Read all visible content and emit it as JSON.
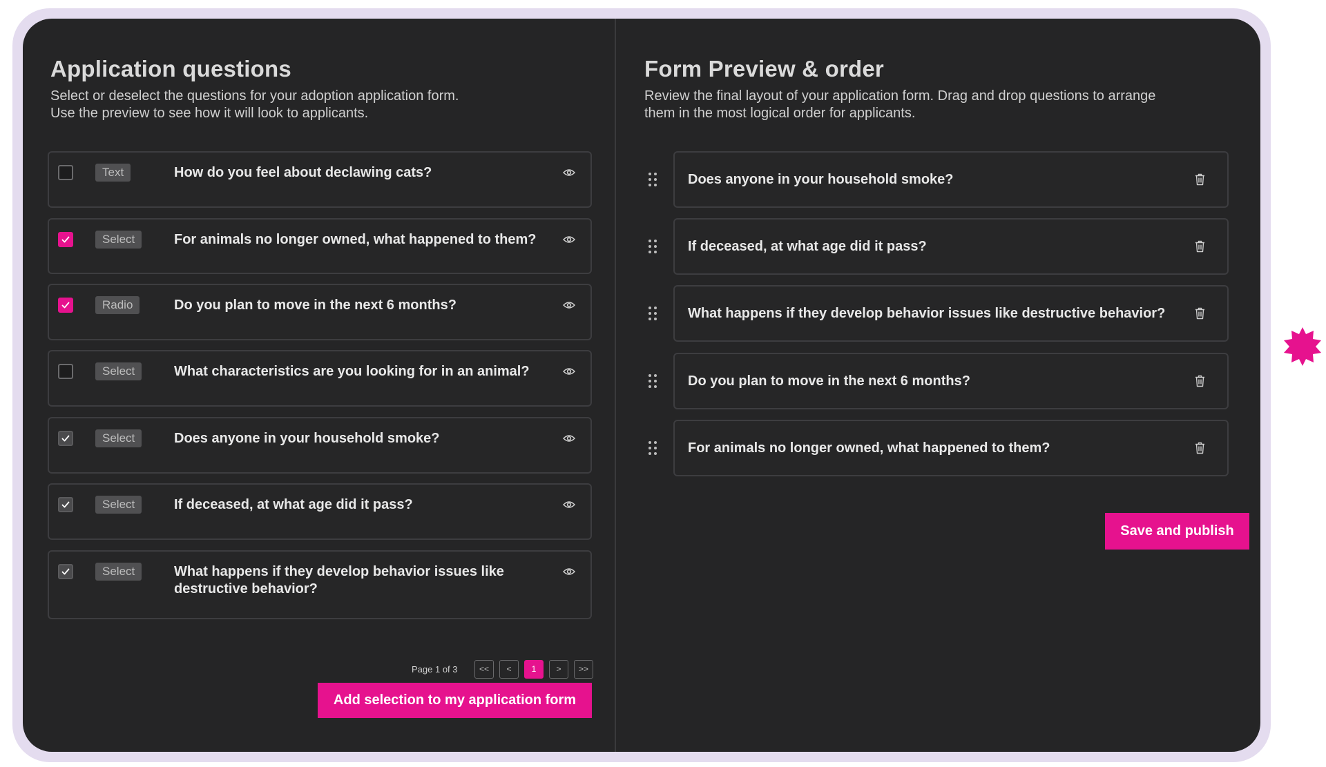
{
  "accent_color": "#e6128e",
  "left": {
    "title": "Application questions",
    "description": "Select or deselect the questions for your adoption application form.\nUse the preview to see how it will look to applicants.",
    "questions": [
      {
        "type": "Text",
        "text": "How do you feel about declawing cats?",
        "checked": false,
        "check_style": "none"
      },
      {
        "type": "Select",
        "text": "For animals no longer owned, what happened to them?",
        "checked": true,
        "check_style": "accent"
      },
      {
        "type": "Radio",
        "text": "Do you plan to move in the next 6 months?",
        "checked": true,
        "check_style": "accent"
      },
      {
        "type": "Select",
        "text": "What characteristics are you looking for in an animal?",
        "checked": false,
        "check_style": "none"
      },
      {
        "type": "Select",
        "text": "Does anyone in your household smoke?",
        "checked": true,
        "check_style": "muted"
      },
      {
        "type": "Select",
        "text": "If deceased, at what age did it pass?",
        "checked": true,
        "check_style": "muted"
      },
      {
        "type": "Select",
        "text": "What happens if they develop behavior issues like destructive behavior?",
        "checked": true,
        "check_style": "muted"
      }
    ],
    "pagination": {
      "label": "Page 1 of 3",
      "first": "<<",
      "prev": "<",
      "current": "1",
      "next": ">",
      "last": ">>"
    },
    "add_button": "Add selection to my application form"
  },
  "right": {
    "title": "Form Preview & order",
    "description": "Review the final layout of your application form. Drag and drop questions to arrange\nthem in the most logical order for applicants.",
    "items": [
      {
        "text": "Does anyone in your household smoke?"
      },
      {
        "text": "If deceased, at what age did it pass?"
      },
      {
        "text": "What happens if they develop behavior issues like destructive behavior?"
      },
      {
        "text": "Do you plan to move in the next 6 months?"
      },
      {
        "text": "For animals no longer owned, what happened to them?"
      }
    ],
    "save_button": "Save and publish"
  },
  "icons": {
    "row_preview": "eye-icon",
    "row_delete": "trash-icon",
    "row_drag": "drag-handle-icon",
    "checkbox_mark": "check-icon",
    "decoration": "starburst-icon"
  }
}
